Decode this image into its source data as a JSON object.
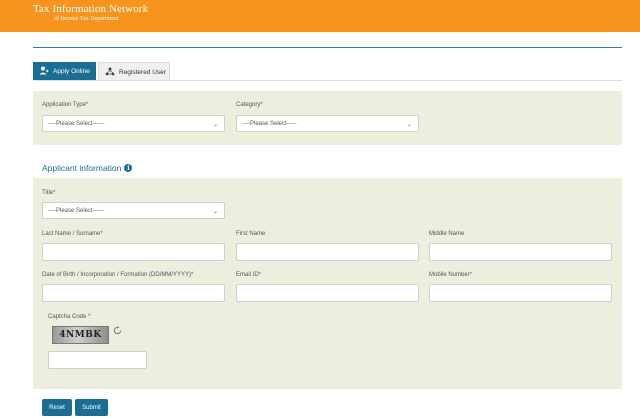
{
  "header": {
    "title": "Tax Information Network",
    "subtitle": "of Income Tax Department"
  },
  "tabs": [
    {
      "label": "Apply Online",
      "icon": "user-apply-icon",
      "active": true
    },
    {
      "label": "Registered User",
      "icon": "network-users-icon",
      "active": false
    }
  ],
  "application": {
    "type_label": "Application Type*",
    "type_value": "----Please Select------",
    "category_label": "Category*",
    "category_value": "----Please Select-----"
  },
  "applicant": {
    "section_title": "Applicant information",
    "info_icon": "i",
    "title_label": "Title*",
    "title_value": "----Please Select------",
    "last_name_label": "Last Name / Surname*",
    "first_name_label": "First Name",
    "middle_name_label": "Middle Name",
    "dob_label": "Date of Birth / Incorporation / Formation (DD/MM/YYYY)*",
    "email_label": "Email ID*",
    "mobile_label": "Mobile Number*",
    "captcha_label": "Captcha Code *",
    "captcha_text": "4NMBK"
  },
  "actions": {
    "reset_label": "Reset",
    "submit_label": "Submit"
  },
  "colors": {
    "header_orange": "#f7941d",
    "accent_blue": "#1a6e94",
    "panel_beige": "#eeeedf"
  }
}
